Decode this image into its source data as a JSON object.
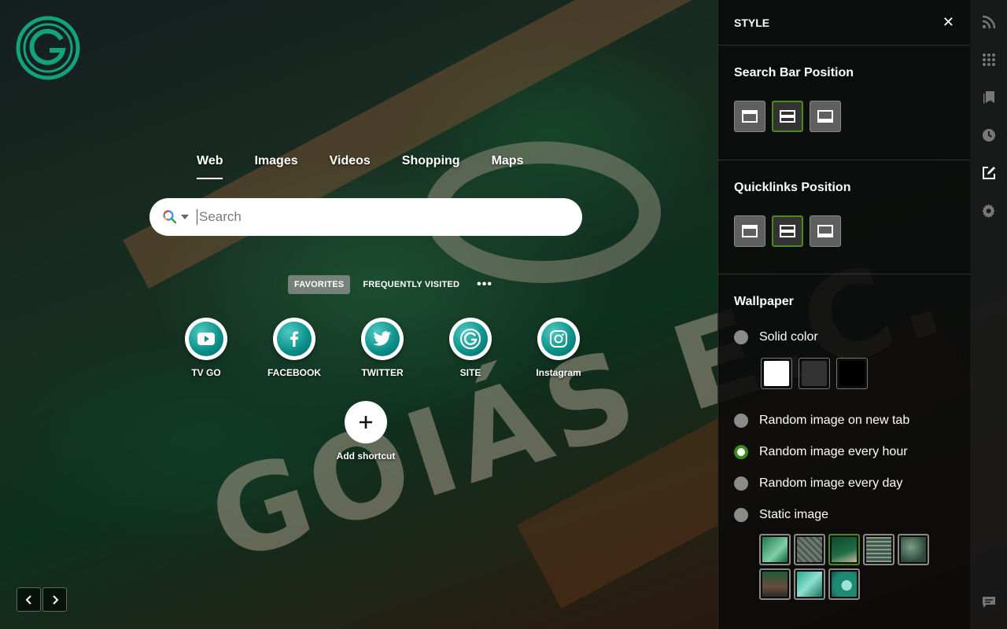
{
  "search_tabs": [
    "Web",
    "Images",
    "Videos",
    "Shopping",
    "Maps"
  ],
  "search": {
    "placeholder": "Search",
    "value": ""
  },
  "quicklinks": {
    "tabs": [
      "FAVORITES",
      "FREQUENTLY VISITED"
    ],
    "more_label": "•••",
    "items": [
      {
        "label": "TV GO",
        "icon": "youtube-icon"
      },
      {
        "label": "FACEBOOK",
        "icon": "facebook-icon"
      },
      {
        "label": "TWITTER",
        "icon": "twitter-icon"
      },
      {
        "label": "SITE",
        "icon": "goias-logo-icon"
      },
      {
        "label": "Instagram",
        "icon": "instagram-icon"
      }
    ],
    "add_label": "Add shortcut"
  },
  "panel": {
    "title": "STYLE",
    "close_glyph": "✕",
    "search_bar_position": {
      "title": "Search Bar Position",
      "options": [
        "top",
        "middle",
        "bottom"
      ],
      "selected": "middle"
    },
    "quicklinks_position": {
      "title": "Quicklinks Position",
      "options": [
        "top",
        "middle",
        "bottom"
      ],
      "selected": "middle"
    },
    "wallpaper": {
      "title": "Wallpaper",
      "options": [
        "Solid color",
        "Random image on new tab",
        "Random image every hour",
        "Random image every day",
        "Static image"
      ],
      "selected": "Random image every hour",
      "solid_colors": [
        "#ffffff",
        "#333333",
        "#000000"
      ],
      "static_thumbnails": 8,
      "selected_thumbnail": 3
    }
  },
  "colors": {
    "accent": "#4b8a1a",
    "brand": "#12a37e"
  },
  "sidebar_icons": [
    "rss-icon",
    "apps-grid-icon",
    "bookmark-icon",
    "history-clock-icon",
    "edit-style-icon",
    "settings-gear-icon",
    "feedback-icon"
  ]
}
